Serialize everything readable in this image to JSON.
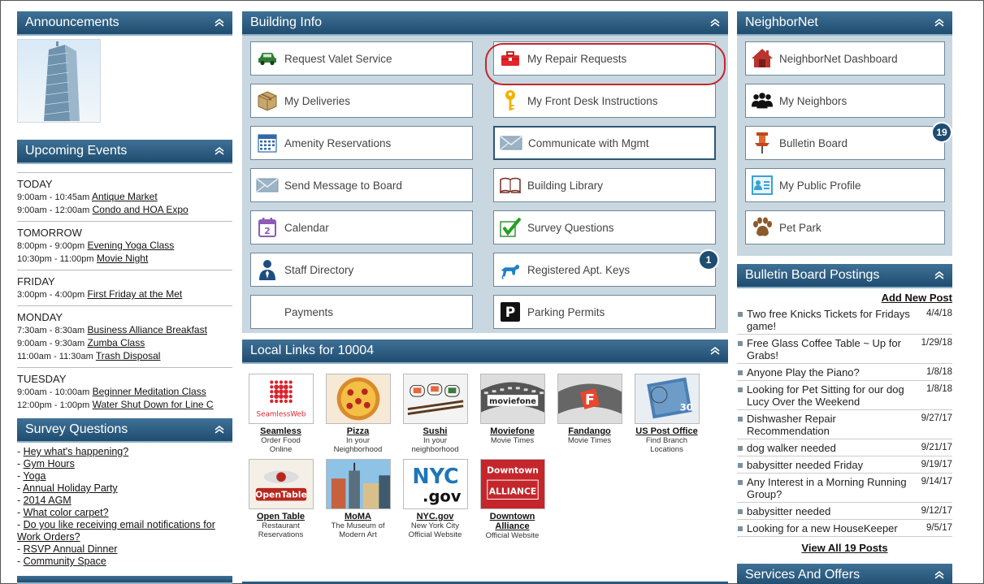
{
  "announcements": {
    "title": "Announcements"
  },
  "upcoming_events": {
    "title": "Upcoming Events",
    "days": [
      {
        "day": "TODAY",
        "events": [
          {
            "time": "9:00am - 10:45am",
            "name": "Antique Market"
          },
          {
            "time": "9:00am - 12:00am",
            "name": "Condo and HOA Expo"
          }
        ]
      },
      {
        "day": "TOMORROW",
        "events": [
          {
            "time": "8:00pm - 9:00pm",
            "name": "Evening Yoga Class"
          },
          {
            "time": "10:30pm - 11:00pm",
            "name": "Movie Night"
          }
        ]
      },
      {
        "day": "FRIDAY",
        "events": [
          {
            "time": "3:00pm - 4:00pm",
            "name": "First Friday at the Met"
          }
        ]
      },
      {
        "day": "MONDAY",
        "events": [
          {
            "time": "7:30am - 8:30am",
            "name": "Business Alliance Breakfast"
          },
          {
            "time": "9:00am - 9:30am",
            "name": "Zumba Class"
          },
          {
            "time": "11:00am - 11:30am",
            "name": "Trash Disposal "
          }
        ]
      },
      {
        "day": "TUESDAY",
        "events": [
          {
            "time": "9:00am - 10:00am",
            "name": "Beginner Meditation Class"
          },
          {
            "time": "12:00pm - 1:00pm",
            "name": "Water Shut Down for Line C"
          }
        ]
      }
    ]
  },
  "survey_questions": {
    "title": "Survey Questions",
    "items": [
      "Hey what's happening?",
      "Gym Hours",
      "Yoga",
      "Annual Holiday Party",
      "2014 AGM",
      "What color carpet?",
      "Do you like receiving email notifications for Work Orders?",
      "RSVP Annual Dinner",
      "Community Space"
    ]
  },
  "building_info": {
    "title": "Building Info",
    "buttons": [
      {
        "label": "Request Valet Service",
        "icon": "car-icon"
      },
      {
        "label": "My Repair Requests",
        "icon": "toolbox-icon"
      },
      {
        "label": "My Deliveries",
        "icon": "package-icon"
      },
      {
        "label": "My Front Desk Instructions",
        "icon": "key-icon"
      },
      {
        "label": "Amenity Reservations",
        "icon": "calendar-grid-icon"
      },
      {
        "label": "Communicate with Mgmt",
        "icon": "envelope-icon"
      },
      {
        "label": "Send Message to Board",
        "icon": "envelope-icon"
      },
      {
        "label": "Building Library",
        "icon": "book-icon"
      },
      {
        "label": "Calendar",
        "icon": "calendar-icon"
      },
      {
        "label": "Survey Questions",
        "icon": "checkmark-icon"
      },
      {
        "label": "Staff Directory",
        "icon": "person-icon"
      },
      {
        "label": "Registered Apt. Keys",
        "icon": "dog-icon",
        "badge": "1"
      },
      {
        "label": "Payments",
        "icon": ""
      },
      {
        "label": "Parking Permits",
        "icon": "parking-icon"
      }
    ]
  },
  "local_links": {
    "title": "Local Links for 10004",
    "tiles": [
      {
        "name": "Seamless",
        "desc1": "Order Food",
        "desc2": "Online",
        "thumb_text": "SeamlessWeb"
      },
      {
        "name": "Pizza",
        "desc1": "In your",
        "desc2": "Neighborhood",
        "thumb_text": ""
      },
      {
        "name": "Sushi",
        "desc1": "In your",
        "desc2": "neighborhood",
        "thumb_text": ""
      },
      {
        "name": "Moviefone",
        "desc1": "Movie Times",
        "desc2": "",
        "thumb_text": "moviefone"
      },
      {
        "name": "Fandango",
        "desc1": "Movie Times",
        "desc2": "",
        "thumb_text": "F"
      },
      {
        "name": "US Post Office",
        "desc1": "Find Branch",
        "desc2": "Locations",
        "thumb_text": "30"
      },
      {
        "name": "Open Table",
        "desc1": "Restaurant",
        "desc2": "Reservations",
        "thumb_text": "OpenTable"
      },
      {
        "name": "MoMA",
        "desc1": "The Museum of",
        "desc2": "Modern Art",
        "thumb_text": ""
      },
      {
        "name": "NYC.gov",
        "desc1": "New York City",
        "desc2": "Official Website",
        "thumb_text": "NYC"
      },
      {
        "name": "Downtown Alliance",
        "desc1": "Official Website",
        "desc2": "",
        "thumb_text": "Downtown"
      }
    ],
    "nyc_sub": ".gov",
    "downtown_sub": "ALLIANCE"
  },
  "neighbornet": {
    "title": "NeighborNet",
    "buttons": [
      {
        "label": "NeighborNet Dashboard",
        "icon": "house-icon"
      },
      {
        "label": "My Neighbors",
        "icon": "people-icon"
      },
      {
        "label": "Bulletin Board",
        "icon": "pushpin-icon",
        "badge": "19"
      },
      {
        "label": "My Public Profile",
        "icon": "profile-card-icon"
      },
      {
        "label": "Pet Park",
        "icon": "paw-icon"
      }
    ]
  },
  "bulletin_board": {
    "title": "Bulletin Board Postings",
    "add_new": "Add New Post",
    "posts": [
      {
        "title": "Two free Knicks Tickets for Fridays game!",
        "date": "4/4/18"
      },
      {
        "title": "Free Glass Coffee Table ~ Up for Grabs!",
        "date": "1/29/18"
      },
      {
        "title": "Anyone Play the Piano?",
        "date": "1/8/18"
      },
      {
        "title": "Looking for Pet Sitting for our dog Lucy Over the Weekend",
        "date": "1/8/18"
      },
      {
        "title": "Dishwasher Repair Recommendation",
        "date": "9/27/17"
      },
      {
        "title": "dog walker needed",
        "date": "9/21/17"
      },
      {
        "title": "babysitter needed Friday",
        "date": "9/19/17"
      },
      {
        "title": "Any Interest in a Morning Running Group?",
        "date": "9/14/17"
      },
      {
        "title": "babysitter needed",
        "date": "9/12/17"
      },
      {
        "title": "Looking for a new HouseKeeper",
        "date": "9/5/17"
      }
    ],
    "view_all": "View All 19 Posts"
  },
  "services": {
    "title": "Services And Offers"
  }
}
